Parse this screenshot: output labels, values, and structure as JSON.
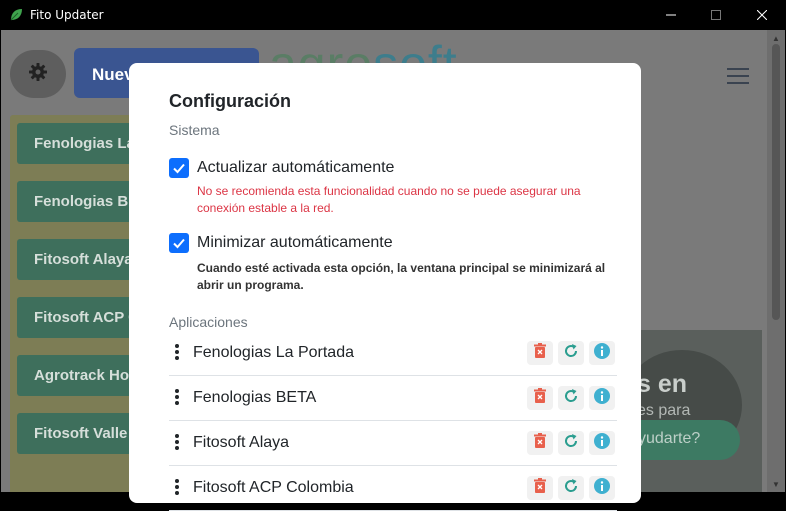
{
  "window": {
    "title": "Fito Updater"
  },
  "background": {
    "new_button_label": "Nuevo",
    "brand_text_a": "agro",
    "brand_text_b": "soft",
    "sidebar_items": [
      "Fenologias La Portada",
      "Fenologias BETA",
      "Fitosoft Alaya",
      "Fitosoft ACP Colombia",
      "Agrotrack Hortalizas",
      "Fitosoft Valle"
    ],
    "hero_text_1": "s en",
    "hero_text_2": "es para",
    "hero_button": "yudarte?"
  },
  "modal": {
    "title": "Configuración",
    "section_system": "Sistema",
    "auto_update": {
      "label": "Actualizar automáticamente",
      "checked": true,
      "help": "No se recomienda esta funcionalidad cuando no se puede asegurar una conexión estable a la red."
    },
    "auto_minimize": {
      "label": "Minimizar automáticamente",
      "checked": true,
      "help": "Cuando esté activada esta opción, la ventana principal se minimizará al abrir un programa."
    },
    "section_apps": "Aplicaciones",
    "apps": [
      "Fenologias La Portada",
      "Fenologias BETA",
      "Fitosoft Alaya",
      "Fitosoft ACP Colombia"
    ]
  },
  "colors": {
    "accent": "#0d6efd",
    "warning_text": "#dc3545",
    "delete_icon": "#e8604c",
    "refresh_icon": "#2a9d8f",
    "info_icon": "#3fb0d0"
  },
  "icons": {
    "app": "leaf-icon",
    "settings": "gear-icon",
    "menu": "hamburger-icon",
    "drag": "drag-handle-icon",
    "delete": "trash-icon",
    "refresh": "refresh-icon",
    "info": "info-icon"
  }
}
